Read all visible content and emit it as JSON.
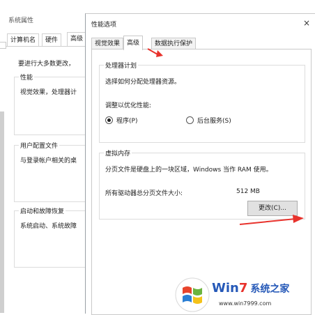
{
  "background_window": {
    "title": "系统属性",
    "tabs": [
      "计算机名",
      "硬件",
      "高级"
    ],
    "intro": "要进行大多数更改，",
    "groups": [
      {
        "legend": "性能",
        "text": "视觉效果，处理器计"
      },
      {
        "legend": "用户配置文件",
        "text": "与登录帐户相关的桌"
      },
      {
        "legend": "启动和故障恢复",
        "text": "系统启动、系统故障"
      }
    ]
  },
  "dialog": {
    "title": "性能选项",
    "close_glyph": "×",
    "tabs": [
      {
        "label": "视觉效果",
        "active": false
      },
      {
        "label": "高级",
        "active": true
      },
      {
        "label": "数据执行保护",
        "active": false
      }
    ],
    "processor": {
      "legend": "处理器计划",
      "description": "选择如何分配处理器资源。",
      "optimize_label": "调整以优化性能:",
      "options": [
        {
          "label": "程序(P)",
          "selected": true
        },
        {
          "label": "后台服务(S)",
          "selected": false
        }
      ]
    },
    "virtual_memory": {
      "legend": "虚拟内存",
      "description": "分页文件是硬盘上的一块区域，Windows 当作 RAM 使用。",
      "total_label": "所有驱动器总分页文件大小:",
      "total_value": "512 MB",
      "change_button": "更改(C)..."
    }
  },
  "annotation_color": "#e8322c",
  "logo": {
    "brand_left": "Win",
    "brand_num": "7",
    "brand_right": "系统之家",
    "url": "www.win7999.com"
  }
}
